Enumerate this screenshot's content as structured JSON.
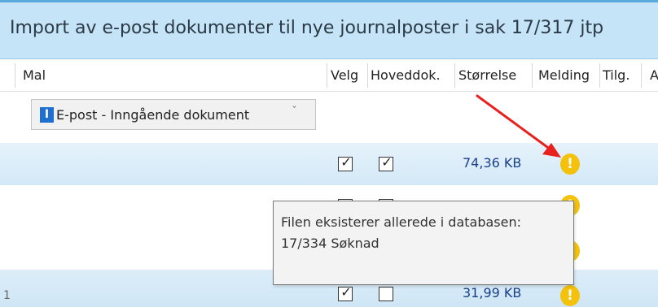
{
  "window": {
    "title": "Import av e-post dokumenter til nye journalposter i sak 17/317 jtp"
  },
  "columns": {
    "mal": "Mal",
    "velg": "Velg",
    "hoveddok": "Hoveddok.",
    "storrelse": "Størrelse",
    "melding": "Melding",
    "tilg": "Tilg.",
    "extra": "A"
  },
  "template_select": {
    "icon_letter": "I",
    "value": "E-post - Inngående dokument",
    "chevron_icon": "chevron-down-icon"
  },
  "rows": [
    {
      "velg": true,
      "hoveddok": true,
      "size": "74,36 KB",
      "warning": "!"
    },
    {
      "velg": true,
      "hoveddok": false,
      "size": "",
      "warning": "!"
    },
    {
      "velg": false,
      "hoveddok": false,
      "size": "",
      "warning": "!"
    },
    {
      "velg": true,
      "hoveddok": false,
      "size": "31,99 KB",
      "warning": "!",
      "number": "1"
    }
  ],
  "tooltip": {
    "line1": "Filen eksisterer allerede i databasen:",
    "line2": "17/334 Søknad"
  },
  "colors": {
    "warning": "#f4c20d",
    "annotation_arrow": "#e8201e",
    "accent": "#5aa9dd"
  }
}
